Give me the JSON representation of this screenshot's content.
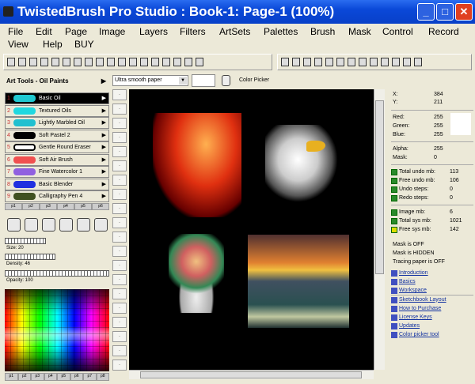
{
  "window": {
    "title": "TwistedBrush Pro Studio : Book-1: Page-1 (100%)",
    "minimize": "_",
    "maximize": "□",
    "close": "✕"
  },
  "menu": [
    "File",
    "Edit",
    "Page",
    "Image",
    "Layers",
    "Filters",
    "ArtSets",
    "Palettes",
    "Brush",
    "Mask",
    "Control",
    "Record",
    "View",
    "Help",
    "BUY"
  ],
  "art_tools": {
    "title": "Art Tools - Oil Paints",
    "items": [
      {
        "num": "1",
        "label": "Basic Oil",
        "color": "#20c8d0"
      },
      {
        "num": "2",
        "label": "Textured Oils",
        "color": "#20d8e0"
      },
      {
        "num": "3",
        "label": "Lightly Marbled Oil",
        "color": "#20c0d0"
      },
      {
        "num": "4",
        "label": "Soft Pastel 2",
        "color": "#000000"
      },
      {
        "num": "5",
        "label": "Gentle Round Eraser",
        "color": "#ffffff"
      },
      {
        "num": "6",
        "label": "Soft Air Brush",
        "color": "#f05050"
      },
      {
        "num": "7",
        "label": "Fine Watercolor 1",
        "color": "#9060e0"
      },
      {
        "num": "8",
        "label": "Basic Blender",
        "color": "#2030e0"
      },
      {
        "num": "9",
        "label": "Calligraphy Pen 4",
        "color": "#405020"
      }
    ],
    "pages": [
      "p1",
      "p2",
      "p3",
      "p4",
      "p5",
      "p6"
    ]
  },
  "sliders": {
    "size": "Size: 20",
    "density": "Density: 46",
    "opacity": "Opacity: 100"
  },
  "palette_pages": [
    "p1",
    "p2",
    "p3",
    "p4",
    "p5",
    "p6",
    "p7",
    "p8"
  ],
  "toolbar2": {
    "paper": "Ultra smooth paper",
    "tool_name": "Color Picker"
  },
  "info": {
    "x_label": "X:",
    "x": "384",
    "y_label": "Y:",
    "y": "211",
    "red_label": "Red:",
    "red": "255",
    "green_label": "Green:",
    "green": "255",
    "blue_label": "Blue:",
    "blue": "255",
    "alpha_label": "Alpha:",
    "alpha": "255",
    "mask_label": "Mask:",
    "mask": "0",
    "stats": [
      {
        "label": "Total undo mb:",
        "value": "113"
      },
      {
        "label": "Free undo mb:",
        "value": "106"
      },
      {
        "label": "Undo steps:",
        "value": "0"
      },
      {
        "label": "Redo steps:",
        "value": "0"
      }
    ],
    "stats2": [
      {
        "label": "Image mb:",
        "value": "6"
      },
      {
        "label": "Total sys mb:",
        "value": "1021"
      },
      {
        "label": "Free sys mb:",
        "value": "142"
      }
    ],
    "status": [
      "Mask is OFF",
      "Mask is HIDDEN",
      "Tracing paper is OFF"
    ],
    "links": [
      "Introduction",
      "Basics",
      "Workspace",
      "Sketchbook Layout",
      "How to Purchase",
      "License Keys",
      "Updates",
      "Color picker tool"
    ]
  }
}
